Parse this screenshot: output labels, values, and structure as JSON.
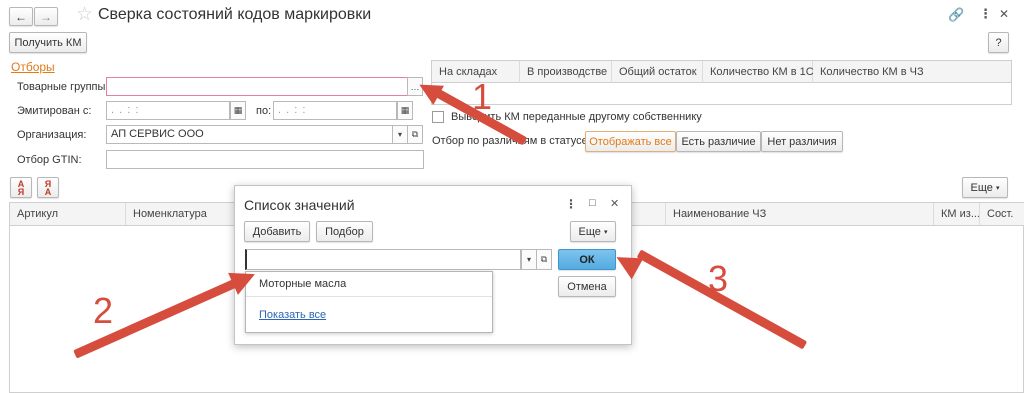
{
  "window": {
    "title": "Сверка состояний кодов маркировки",
    "help": "?"
  },
  "toolbar": {
    "get_km": "Получить КМ",
    "more": "Еще"
  },
  "filters": {
    "heading": "Отборы",
    "product_groups_label": "Товарные группы:",
    "emitted_label": "Эмитирован с:",
    "date_placeholder": ". .   : :",
    "to_label": "по:",
    "org_label": "Организация:",
    "org_value": "АП СЕРВИС ООО",
    "gtin_label": "Отбор GTIN:"
  },
  "summary_table": {
    "columns": [
      "На складах",
      "В производстве",
      "Общий остаток",
      "Количество КМ в 1С",
      "Количество КМ в ЧЗ"
    ]
  },
  "options": {
    "checkbox_label": "Выводить КМ переданные другому собственнику",
    "diff_label": "Отбор по различиям в статусе:",
    "diff_options": [
      "Отображать все",
      "Есть различие",
      "Нет различия"
    ],
    "diff_selected": "Отображать все"
  },
  "main_table": {
    "columns": [
      "Артикул",
      "Номенклатура",
      "Наименование ЧЗ",
      "КМ из...",
      "Сост."
    ]
  },
  "dialog": {
    "title": "Список значений",
    "add": "Добавить",
    "select": "Подбор",
    "more": "Еще",
    "input_value": "",
    "ok": "ОК",
    "cancel": "Отмена",
    "dropdown_item": "Моторные масла",
    "show_all": "Показать все"
  },
  "annotations": {
    "n1": "1",
    "n2": "2",
    "n3": "3"
  },
  "colors": {
    "accent_orange": "#e07b17",
    "annotation_red": "#d64d3e",
    "link_blue": "#2a66b8",
    "ok_blue": "#5fb3e6"
  }
}
